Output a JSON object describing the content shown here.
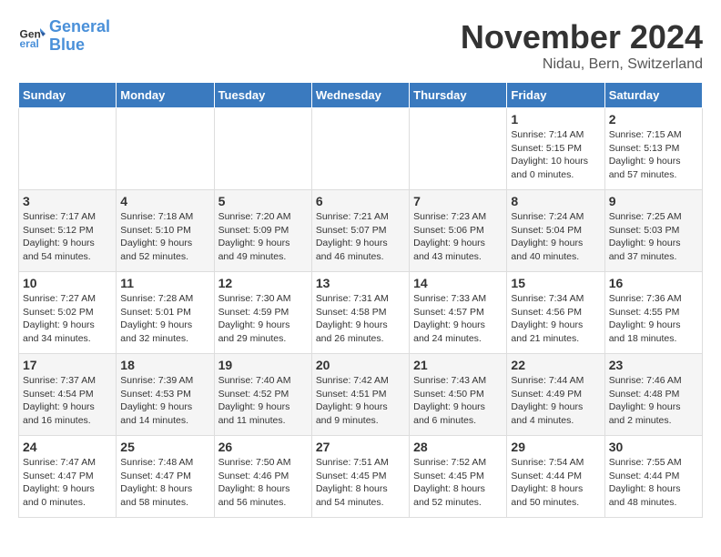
{
  "header": {
    "logo_line1": "General",
    "logo_line2": "Blue",
    "title": "November 2024",
    "subtitle": "Nidau, Bern, Switzerland"
  },
  "columns": [
    "Sunday",
    "Monday",
    "Tuesday",
    "Wednesday",
    "Thursday",
    "Friday",
    "Saturday"
  ],
  "weeks": [
    {
      "days": [
        {
          "num": "",
          "info": ""
        },
        {
          "num": "",
          "info": ""
        },
        {
          "num": "",
          "info": ""
        },
        {
          "num": "",
          "info": ""
        },
        {
          "num": "",
          "info": ""
        },
        {
          "num": "1",
          "info": "Sunrise: 7:14 AM\nSunset: 5:15 PM\nDaylight: 10 hours\nand 0 minutes."
        },
        {
          "num": "2",
          "info": "Sunrise: 7:15 AM\nSunset: 5:13 PM\nDaylight: 9 hours\nand 57 minutes."
        }
      ]
    },
    {
      "days": [
        {
          "num": "3",
          "info": "Sunrise: 7:17 AM\nSunset: 5:12 PM\nDaylight: 9 hours\nand 54 minutes."
        },
        {
          "num": "4",
          "info": "Sunrise: 7:18 AM\nSunset: 5:10 PM\nDaylight: 9 hours\nand 52 minutes."
        },
        {
          "num": "5",
          "info": "Sunrise: 7:20 AM\nSunset: 5:09 PM\nDaylight: 9 hours\nand 49 minutes."
        },
        {
          "num": "6",
          "info": "Sunrise: 7:21 AM\nSunset: 5:07 PM\nDaylight: 9 hours\nand 46 minutes."
        },
        {
          "num": "7",
          "info": "Sunrise: 7:23 AM\nSunset: 5:06 PM\nDaylight: 9 hours\nand 43 minutes."
        },
        {
          "num": "8",
          "info": "Sunrise: 7:24 AM\nSunset: 5:04 PM\nDaylight: 9 hours\nand 40 minutes."
        },
        {
          "num": "9",
          "info": "Sunrise: 7:25 AM\nSunset: 5:03 PM\nDaylight: 9 hours\nand 37 minutes."
        }
      ]
    },
    {
      "days": [
        {
          "num": "10",
          "info": "Sunrise: 7:27 AM\nSunset: 5:02 PM\nDaylight: 9 hours\nand 34 minutes."
        },
        {
          "num": "11",
          "info": "Sunrise: 7:28 AM\nSunset: 5:01 PM\nDaylight: 9 hours\nand 32 minutes."
        },
        {
          "num": "12",
          "info": "Sunrise: 7:30 AM\nSunset: 4:59 PM\nDaylight: 9 hours\nand 29 minutes."
        },
        {
          "num": "13",
          "info": "Sunrise: 7:31 AM\nSunset: 4:58 PM\nDaylight: 9 hours\nand 26 minutes."
        },
        {
          "num": "14",
          "info": "Sunrise: 7:33 AM\nSunset: 4:57 PM\nDaylight: 9 hours\nand 24 minutes."
        },
        {
          "num": "15",
          "info": "Sunrise: 7:34 AM\nSunset: 4:56 PM\nDaylight: 9 hours\nand 21 minutes."
        },
        {
          "num": "16",
          "info": "Sunrise: 7:36 AM\nSunset: 4:55 PM\nDaylight: 9 hours\nand 18 minutes."
        }
      ]
    },
    {
      "days": [
        {
          "num": "17",
          "info": "Sunrise: 7:37 AM\nSunset: 4:54 PM\nDaylight: 9 hours\nand 16 minutes."
        },
        {
          "num": "18",
          "info": "Sunrise: 7:39 AM\nSunset: 4:53 PM\nDaylight: 9 hours\nand 14 minutes."
        },
        {
          "num": "19",
          "info": "Sunrise: 7:40 AM\nSunset: 4:52 PM\nDaylight: 9 hours\nand 11 minutes."
        },
        {
          "num": "20",
          "info": "Sunrise: 7:42 AM\nSunset: 4:51 PM\nDaylight: 9 hours\nand 9 minutes."
        },
        {
          "num": "21",
          "info": "Sunrise: 7:43 AM\nSunset: 4:50 PM\nDaylight: 9 hours\nand 6 minutes."
        },
        {
          "num": "22",
          "info": "Sunrise: 7:44 AM\nSunset: 4:49 PM\nDaylight: 9 hours\nand 4 minutes."
        },
        {
          "num": "23",
          "info": "Sunrise: 7:46 AM\nSunset: 4:48 PM\nDaylight: 9 hours\nand 2 minutes."
        }
      ]
    },
    {
      "days": [
        {
          "num": "24",
          "info": "Sunrise: 7:47 AM\nSunset: 4:47 PM\nDaylight: 9 hours\nand 0 minutes."
        },
        {
          "num": "25",
          "info": "Sunrise: 7:48 AM\nSunset: 4:47 PM\nDaylight: 8 hours\nand 58 minutes."
        },
        {
          "num": "26",
          "info": "Sunrise: 7:50 AM\nSunset: 4:46 PM\nDaylight: 8 hours\nand 56 minutes."
        },
        {
          "num": "27",
          "info": "Sunrise: 7:51 AM\nSunset: 4:45 PM\nDaylight: 8 hours\nand 54 minutes."
        },
        {
          "num": "28",
          "info": "Sunrise: 7:52 AM\nSunset: 4:45 PM\nDaylight: 8 hours\nand 52 minutes."
        },
        {
          "num": "29",
          "info": "Sunrise: 7:54 AM\nSunset: 4:44 PM\nDaylight: 8 hours\nand 50 minutes."
        },
        {
          "num": "30",
          "info": "Sunrise: 7:55 AM\nSunset: 4:44 PM\nDaylight: 8 hours\nand 48 minutes."
        }
      ]
    }
  ]
}
